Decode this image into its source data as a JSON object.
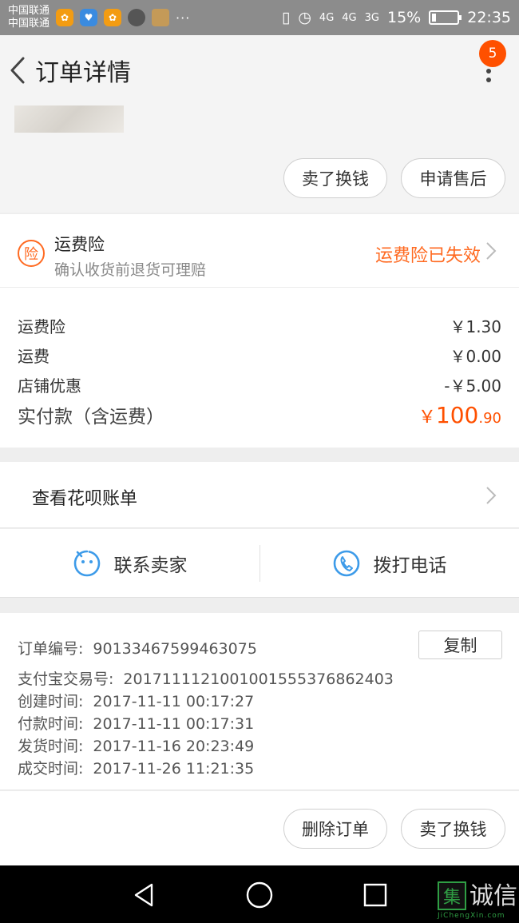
{
  "statusbar": {
    "carrier1": "中国联通",
    "carrier2": "中国联通",
    "dots": "···",
    "network1": "4G",
    "network2": "4G",
    "network3": "3G",
    "battery": "15%",
    "time": "22:35"
  },
  "header": {
    "title": "订单详情",
    "badge_count": "5"
  },
  "product_actions": {
    "sell_label": "卖了换钱",
    "aftersale_label": "申请售后"
  },
  "insurance": {
    "icon_char": "险",
    "title": "运费险",
    "subtitle": "确认收货前退货可理赔",
    "status": "运费险已失效"
  },
  "prices": {
    "rows": [
      {
        "label": "运费险",
        "amount": "￥1.30"
      },
      {
        "label": "运费",
        "amount": "￥0.00"
      },
      {
        "label": "店铺优惠",
        "amount": "-￥5.00"
      }
    ],
    "total_label": "实付款（含运费）",
    "total_currency": "￥",
    "total_integer": "100",
    "total_decimal": ".90"
  },
  "huabei": {
    "label": "查看花呗账单"
  },
  "contact": {
    "seller_label": "联系卖家",
    "phone_label": "拨打电话"
  },
  "order_info": {
    "order_no_label": "订单编号:",
    "order_no": "90133467599463075",
    "copy_label": "复制",
    "alipay_no_label": "支付宝交易号:",
    "alipay_no": "2017111121001001555376862403",
    "created_label": "创建时间:",
    "created": "2017-11-11 00:17:27",
    "paid_label": "付款时间:",
    "paid": "2017-11-11 00:17:31",
    "shipped_label": "发货时间:",
    "shipped": "2017-11-16 20:23:49",
    "completed_label": "成交时间:",
    "completed": "2017-11-26 11:21:35"
  },
  "bottom_actions": {
    "delete_label": "删除订单",
    "sell_label": "卖了换钱"
  },
  "watermark": {
    "logo_char": "集",
    "text": "诚信",
    "url": "JiChengXin.com"
  },
  "colors": {
    "accent": "#ff5000",
    "insurance_orange": "#ff6a21",
    "contact_blue": "#3d9be9"
  }
}
